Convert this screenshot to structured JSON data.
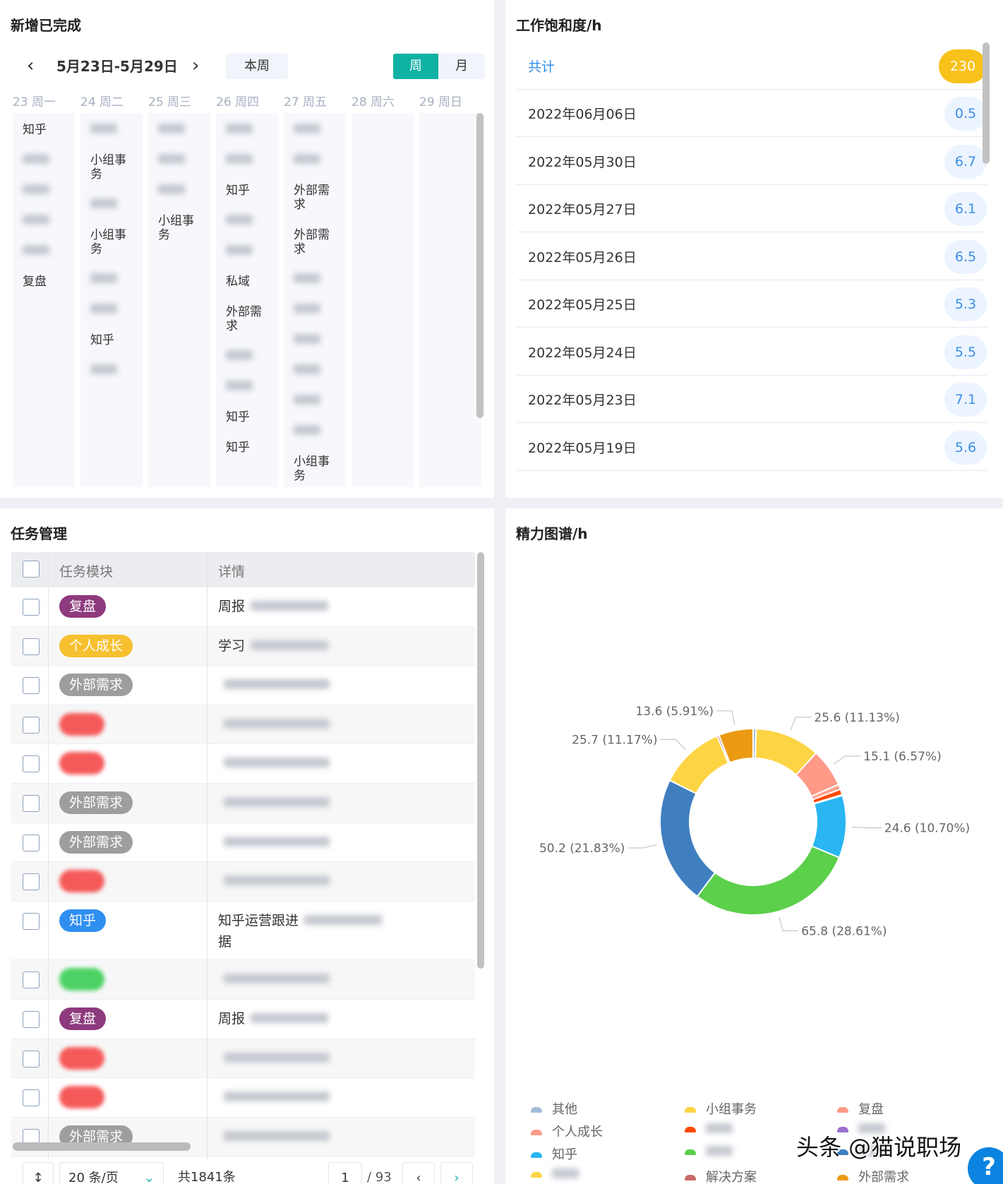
{
  "completed": {
    "title": "新增已完成",
    "date_range": "5月23日-5月29日",
    "this_week": "本周",
    "week": "周",
    "month": "月",
    "accent": "#10b2a4",
    "days": [
      "23 周一",
      "24 周二",
      "25 周三",
      "26 周四",
      "27 周五",
      "28 周六",
      "29 周日"
    ],
    "columns": [
      [
        "知乎",
        "",
        "",
        "",
        "",
        "复盘"
      ],
      [
        "",
        "小组事务",
        "",
        "小组事务",
        "",
        "",
        "知乎",
        ""
      ],
      [
        "",
        "",
        "",
        "小组事务"
      ],
      [
        "",
        "",
        "知乎",
        "",
        "",
        "私域",
        "外部需求",
        "",
        "",
        "知乎",
        "知乎"
      ],
      [
        "",
        "",
        "外部需求",
        "外部需求",
        "",
        "",
        "",
        "",
        "",
        "",
        "小组事务"
      ],
      [],
      []
    ]
  },
  "saturation": {
    "title": "工作饱和度/h",
    "total_label": "共计",
    "total": "230",
    "rows": [
      {
        "date": "2022年06月06日",
        "value": "0.5"
      },
      {
        "date": "2022年05月30日",
        "value": "6.7"
      },
      {
        "date": "2022年05月27日",
        "value": "6.1"
      },
      {
        "date": "2022年05月26日",
        "value": "6.5"
      },
      {
        "date": "2022年05月25日",
        "value": "5.3"
      },
      {
        "date": "2022年05月24日",
        "value": "5.5"
      },
      {
        "date": "2022年05月23日",
        "value": "7.1"
      },
      {
        "date": "2022年05月19日",
        "value": "5.6"
      }
    ]
  },
  "tasks": {
    "title": "任务管理",
    "col_module": "任务模块",
    "col_detail": "详情",
    "rows": [
      {
        "tag": "复盘",
        "color": "#8e3a7e",
        "detail": "周报"
      },
      {
        "tag": "个人成长",
        "color": "#f6c02f",
        "detail": "学习"
      },
      {
        "tag": "外部需求",
        "color": "#9e9e9e",
        "detail": ""
      },
      {
        "tag": "",
        "color": "#f55a5a",
        "detail": ""
      },
      {
        "tag": "",
        "color": "#f55a5a",
        "detail": ""
      },
      {
        "tag": "外部需求",
        "color": "#9e9e9e",
        "detail": ""
      },
      {
        "tag": "外部需求",
        "color": "#9e9e9e",
        "detail": ""
      },
      {
        "tag": "",
        "color": "#f55a5a",
        "detail": ""
      },
      {
        "tag": "知乎",
        "color": "#2f8ff0",
        "detail": "知乎运营跟进",
        "detail2": "据"
      },
      {
        "tag": "",
        "color": "#4cd264",
        "detail": ""
      },
      {
        "tag": "复盘",
        "color": "#8e3a7e",
        "detail": "周报"
      },
      {
        "tag": "",
        "color": "#f55a5a",
        "detail": ""
      },
      {
        "tag": "",
        "color": "#f55a5a",
        "detail": ""
      },
      {
        "tag": "外部需求",
        "color": "#9e9e9e",
        "detail": ""
      }
    ],
    "page_size": "20 条/页",
    "total": "共1841条",
    "page": "1",
    "pages": "/ 93"
  },
  "chart_data": {
    "type": "pie",
    "title": "精力图谱/h",
    "donut": true,
    "slices": [
      {
        "name": "其他",
        "value": 1.2,
        "color": "#a3bcd9",
        "label": ""
      },
      {
        "name": "小组事务",
        "value": 25.6,
        "color": "#fdd443",
        "label": "25.6 (11.13%)"
      },
      {
        "name": "复盘",
        "value": 15.1,
        "color": "#ff9a88",
        "label": "15.1 (6.57%)"
      },
      {
        "name": "个人成长",
        "value": 2.0,
        "color": "#ff9f8f",
        "label": ""
      },
      {
        "name": "",
        "value": 2.2,
        "color": "#ff4a00",
        "label": ""
      },
      {
        "name": "",
        "value": 0.3,
        "color": "#9b6fd1",
        "label": ""
      },
      {
        "name": "知乎",
        "value": 24.6,
        "color": "#29b6f2",
        "label": "24.6 (10.70%)"
      },
      {
        "name": "",
        "value": 65.8,
        "color": "#5ccf4b",
        "label": "65.8 (28.61%)"
      },
      {
        "name": "",
        "value": 50.2,
        "color": "#3f7fc0",
        "label": "50.2 (21.83%)"
      },
      {
        "name": "",
        "value": 25.7,
        "color": "#fdd443",
        "label": "25.7 (11.17%)"
      },
      {
        "name": "解决方案",
        "value": 0.8,
        "color": "#c96a6a",
        "label": ""
      },
      {
        "name": "外部需求",
        "value": 13.6,
        "color": "#ec9a14",
        "label": "13.6 (5.91%)"
      }
    ],
    "legend": [
      {
        "name": "其他",
        "color": "#a3bcd9"
      },
      {
        "name": "小组事务",
        "color": "#fdd443"
      },
      {
        "name": "复盘",
        "color": "#ff9a88"
      },
      {
        "name": "个人成长",
        "color": "#ff9a88"
      },
      {
        "name": "",
        "color": "#ff4a00"
      },
      {
        "name": "",
        "color": "#9b6fd1"
      },
      {
        "name": "知乎",
        "color": "#29b6f2"
      },
      {
        "name": "",
        "color": "#5ccf4b"
      },
      {
        "name": "",
        "color": "#3f7fc0"
      },
      {
        "name": "",
        "color": "#fdd443"
      },
      {
        "name": "解决方案",
        "color": "#c96a6a"
      },
      {
        "name": "外部需求",
        "color": "#ec9a14"
      }
    ]
  },
  "watermark": "头条 @猫说职场"
}
